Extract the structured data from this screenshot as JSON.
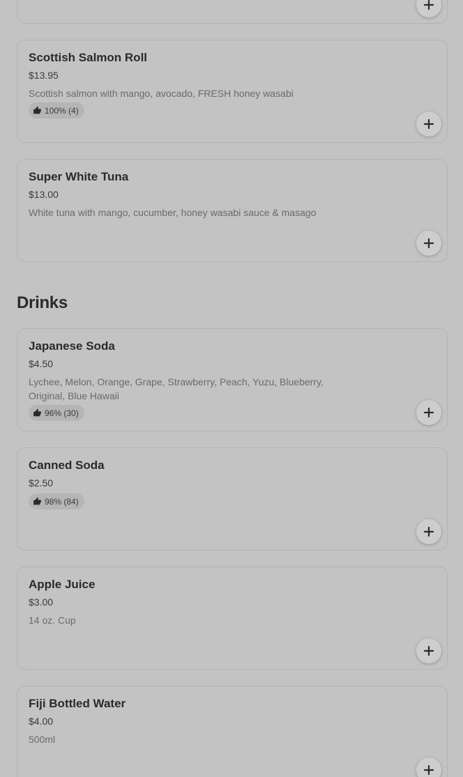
{
  "sections": [
    {
      "items": [
        {
          "name": "Scottish Salmon Roll",
          "price": "$13.95",
          "description": "Scottish salmon with mango, avocado, FRESH honey wasabi",
          "rating": "100% (4)",
          "add_icon": "plus-icon"
        },
        {
          "name": "Super White Tuna",
          "price": "$13.00",
          "description": "White tuna with mango, cucumber, honey wasabi sauce & masago",
          "add_icon": "plus-icon"
        }
      ]
    },
    {
      "title": "Drinks",
      "items": [
        {
          "name": "Japanese Soda",
          "price": "$4.50",
          "description": "Lychee, Melon, Orange, Grape, Strawberry, Peach, Yuzu, Blueberry, Original, Blue Hawaii",
          "rating": "96% (30)",
          "add_icon": "plus-icon"
        },
        {
          "name": "Canned Soda",
          "price": "$2.50",
          "rating": "98% (84)",
          "add_icon": "plus-icon"
        },
        {
          "name": "Apple Juice",
          "price": "$3.00",
          "description": "14 oz. Cup",
          "add_icon": "plus-icon"
        },
        {
          "name": "Fiji Bottled Water",
          "price": "$4.00",
          "description": "500ml",
          "add_icon": "plus-icon"
        }
      ]
    }
  ],
  "icons": {
    "rating": "thumbs-up-icon",
    "add": "plus-icon"
  },
  "colors": {
    "background": "#c3c3c3",
    "card_border": "#b3b3b3",
    "text_primary": "#2a2a2a",
    "text_secondary": "#6a6a6a"
  }
}
